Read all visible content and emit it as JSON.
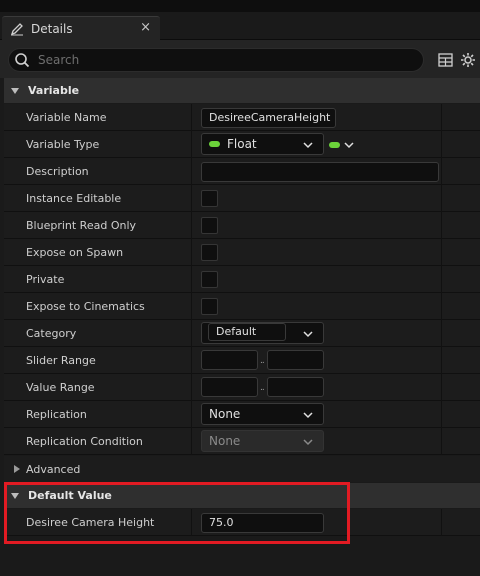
{
  "tab": {
    "title": "Details",
    "close": "×",
    "icon": "pencil-icon"
  },
  "search": {
    "placeholder": "Search",
    "value": ""
  },
  "toolbar": {
    "table_icon": "table-icon",
    "settings_icon": "gear-icon"
  },
  "sections": {
    "variable": "Variable",
    "advanced": "Advanced",
    "default_value": "Default Value"
  },
  "rows": {
    "variable_name": {
      "label": "Variable Name",
      "value": "DesireeCameraHeight"
    },
    "variable_type": {
      "label": "Variable Type",
      "value": "Float"
    },
    "description": {
      "label": "Description",
      "value": ""
    },
    "instance_editable": {
      "label": "Instance Editable"
    },
    "blueprint_read_only": {
      "label": "Blueprint Read Only"
    },
    "expose_on_spawn": {
      "label": "Expose on Spawn"
    },
    "private": {
      "label": "Private"
    },
    "expose_to_cinematics": {
      "label": "Expose to Cinematics"
    },
    "category": {
      "label": "Category",
      "value": "Default"
    },
    "slider_range": {
      "label": "Slider Range",
      "separator": "..",
      "min": "",
      "max": ""
    },
    "value_range": {
      "label": "Value Range",
      "separator": "..",
      "min": "",
      "max": ""
    },
    "replication": {
      "label": "Replication",
      "value": "None"
    },
    "replication_condition": {
      "label": "Replication Condition",
      "value": "None"
    }
  },
  "default_value": {
    "label": "Desiree Camera Height",
    "value": "75.0"
  },
  "colors": {
    "float_pin": "#6bd23a",
    "highlight": "#e21b23"
  }
}
